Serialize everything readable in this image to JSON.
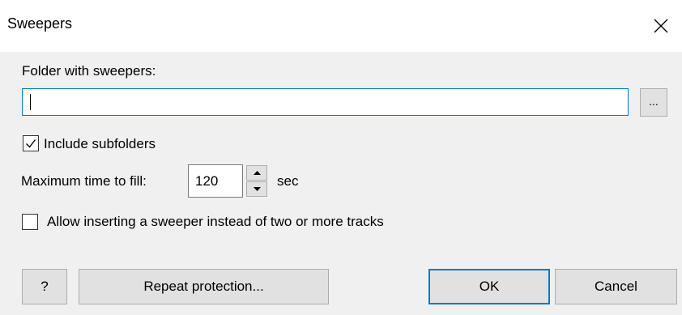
{
  "window": {
    "title": "Sweepers"
  },
  "folder": {
    "label": "Folder with sweepers:",
    "value": "",
    "browse_label": "..."
  },
  "include_subfolders": {
    "label": "Include subfolders",
    "checked": true
  },
  "max_time": {
    "label": "Maximum time to fill:",
    "value": "120",
    "unit": "sec"
  },
  "allow_inserting": {
    "label": "Allow inserting a sweeper instead of two or more tracks",
    "checked": false
  },
  "buttons": {
    "help": "?",
    "repeat_protection": "Repeat protection...",
    "ok": "OK",
    "cancel": "Cancel"
  },
  "icons": {
    "close": "close-icon",
    "check": "check-icon",
    "spin_up": "up-arrow-icon",
    "spin_down": "down-arrow-icon"
  },
  "colors": {
    "accent": "#0078d7",
    "dialog_bg": "#f0f0f0",
    "button_bg": "#e1e1e1"
  }
}
